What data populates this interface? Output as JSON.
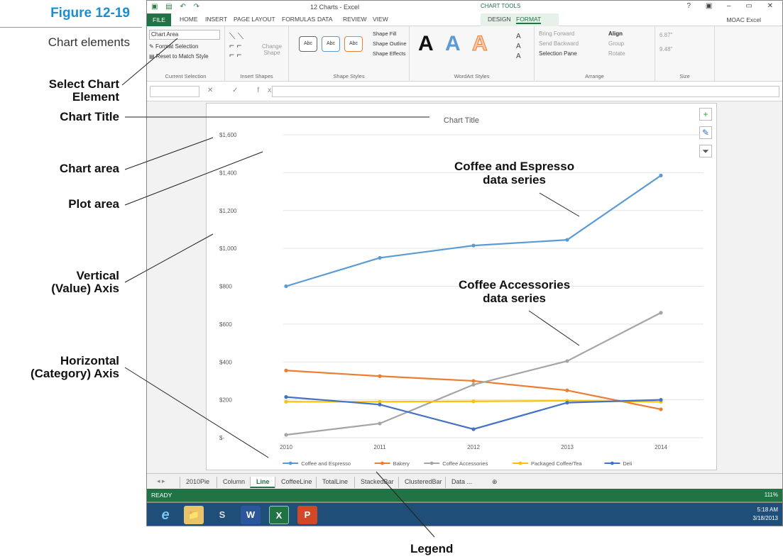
{
  "figure": {
    "number": "Figure 12-19",
    "caption": "Chart elements",
    "callouts": {
      "select_chart_element": [
        "Select Chart",
        "Element"
      ],
      "chart_title": "Chart Title",
      "chart_area": "Chart area",
      "plot_area": "Plot area",
      "vertical_axis": [
        "Vertical",
        "(Value) Axis"
      ],
      "horizontal_axis": [
        "Horizontal",
        "(Category) Axis"
      ],
      "coffee_series": [
        "Coffee and Espresso",
        "data series"
      ],
      "accessories_series": [
        "Coffee Accessories",
        "data series"
      ],
      "legend": "Legend"
    }
  },
  "excel": {
    "window_title": "12 Charts - Excel",
    "chart_tools_label": "CHART TOOLS",
    "window_controls": "? ▣ – ▭ ✕",
    "account": "MOAC Excel",
    "tabs": [
      "FILE",
      "HOME",
      "INSERT",
      "PAGE LAYOUT",
      "FORMULAS",
      "DATA",
      "REVIEW",
      "VIEW",
      "DESIGN",
      "FORMAT"
    ],
    "ribbon": {
      "current_selection": {
        "dropdown_value": "Chart Area",
        "format_selection": "Format Selection",
        "reset_to_match": "Reset to Match Style",
        "group_name": "Current Selection"
      },
      "insert_shapes": {
        "change_shape": [
          "Change",
          "Shape"
        ],
        "group_name": "Insert Shapes"
      },
      "shape_styles": {
        "swatches": [
          "Abc",
          "Abc",
          "Abc"
        ],
        "shape_fill": "Shape Fill",
        "shape_outline": "Shape Outline",
        "shape_effects": "Shape Effects",
        "group_name": "Shape Styles"
      },
      "wordart_styles": {
        "letters": [
          "A",
          "A",
          "A"
        ],
        "group_name": "WordArt Styles"
      },
      "arrange": {
        "bring_forward": "Bring Forward",
        "send_backward": "Send Backward",
        "selection_pane": "Selection Pane",
        "align": "Align",
        "group": "Group",
        "rotate": "Rotate",
        "group_name": "Arrange"
      },
      "size": {
        "height": "6.87\"",
        "width": "9.48\"",
        "group_name": "Size"
      }
    },
    "formula_icons": "✕ ✓ fx",
    "sheet_tabs": [
      "2010Pie",
      "Column",
      "Line",
      "CoffeeLine",
      "TotalLine",
      "StackedBar",
      "ClusteredBar",
      "Data ..."
    ],
    "active_sheet": "Line",
    "status": "READY",
    "zoom": "111%",
    "clock": {
      "time": "5:18 AM",
      "date": "3/18/2013"
    },
    "taskbar_icons": [
      "e",
      "📁",
      "S",
      "W",
      "X",
      "P"
    ]
  },
  "chart_data": {
    "type": "line",
    "title": "Chart Title",
    "categories": [
      "2010",
      "2011",
      "2012",
      "2013",
      "2014"
    ],
    "ylim": [
      0,
      1600
    ],
    "yticks": [
      "$-",
      "$200",
      "$400",
      "$600",
      "$800",
      "$1,000",
      "$1,200",
      "$1,400",
      "$1,600"
    ],
    "ytick_values": [
      0,
      200,
      400,
      600,
      800,
      1000,
      1200,
      1400,
      1600
    ],
    "grid": true,
    "legend_position": "bottom",
    "series": [
      {
        "name": "Coffee and Espresso",
        "color": "#5b9bd5",
        "values": [
          800,
          950,
          1015,
          1045,
          1385
        ]
      },
      {
        "name": "Bakery",
        "color": "#ed7d31",
        "values": [
          355,
          325,
          300,
          250,
          150
        ]
      },
      {
        "name": "Coffee Accessories",
        "color": "#a5a5a5",
        "values": [
          15,
          75,
          280,
          405,
          660
        ]
      },
      {
        "name": "Packaged Coffee/Tea",
        "color": "#ffc000",
        "values": [
          190,
          190,
          192,
          195,
          190
        ]
      },
      {
        "name": "Deli",
        "color": "#4472c4",
        "values": [
          215,
          175,
          45,
          185,
          200
        ]
      }
    ]
  }
}
